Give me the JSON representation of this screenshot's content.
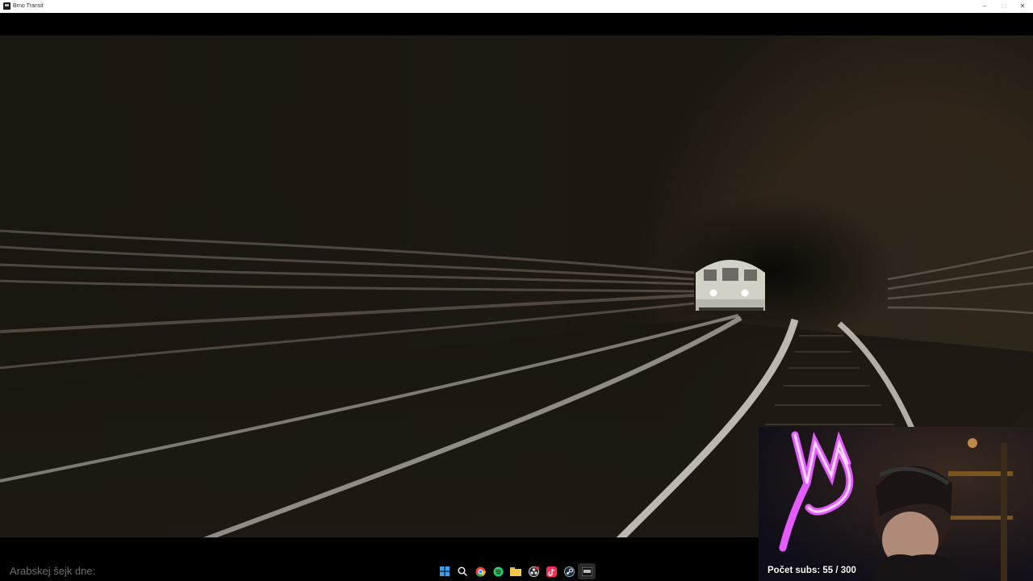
{
  "window": {
    "title": "Brno Transit",
    "controls": {
      "minimize": "–",
      "maximize": "□",
      "close": "✕"
    }
  },
  "stream": {
    "ticker_text": "Arabskej šejk dne:",
    "subscriber_counter": "Počet subs: 55 / 300"
  },
  "taskbar": {
    "icons": [
      "windows-start-icon",
      "search-icon",
      "chrome-icon",
      "spotify-icon",
      "file-explorer-icon",
      "obs-icon",
      "tiktok-icon",
      "steam-icon",
      "game-window-icon"
    ]
  },
  "colors": {
    "tunnel_wall": "#2b2319",
    "rail": "#cfcac3",
    "train_body": "#d3d1c7",
    "headlight": "#ffffff",
    "neon": "#e25bff"
  }
}
